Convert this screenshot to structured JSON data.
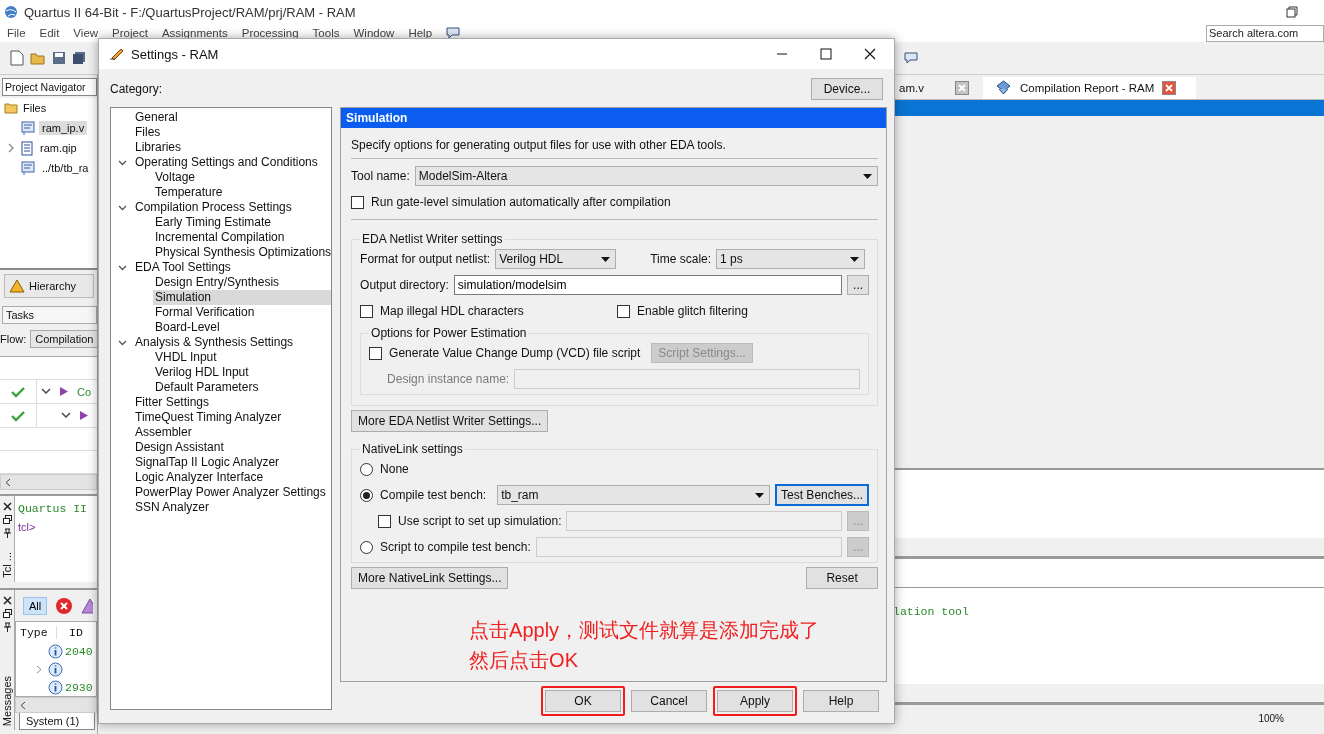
{
  "main_window": {
    "title": "Quartus II 64-Bit - F:/QuartusProject/RAM/prj/RAM - RAM",
    "menu": [
      "File",
      "Edit",
      "View",
      "Project",
      "Assignments",
      "Processing",
      "Tools",
      "Window",
      "Help"
    ],
    "search": {
      "placeholder": "Search altera.com"
    },
    "navigator": {
      "label": "Project Navigator",
      "files": {
        "label": "Files",
        "children": [
          {
            "label": "ram_ip.v",
            "kind": "source",
            "expandable": false,
            "selected": true
          },
          {
            "label": "ram.qip",
            "kind": "list",
            "expandable": true,
            "selected": false
          },
          {
            "label": "../tb/tb_ra",
            "kind": "source",
            "expandable": false,
            "selected": false
          }
        ]
      },
      "tab": "Hierarchy"
    },
    "tasks": {
      "label": "Tasks",
      "flow_label": "Flow:",
      "flow": "Compilation",
      "rows": [
        {
          "done": true,
          "label": "Co",
          "children": [
            {
              "done": true
            }
          ]
        }
      ]
    },
    "tcl": {
      "tab": "Tcl ...",
      "lines": [
        {
          "kind": "output",
          "text": "Quartus II"
        },
        {
          "kind": "prompt",
          "text": "tcl>"
        }
      ]
    },
    "messages": {
      "tab": "Messages",
      "filter": "All",
      "columns": [
        "Type",
        "ID"
      ],
      "rows": [
        {
          "id": "2040",
          "expandable": false
        },
        {
          "expandable": true
        },
        {
          "id": "2930",
          "expandable": false
        }
      ],
      "bottom_tab": "System (1)"
    },
    "documents": [
      {
        "label": "am.v",
        "selected": false
      },
      {
        "label": "Compilation Report - RAM",
        "selected": true
      }
    ],
    "message_text": "lation tool",
    "zoom": "100%"
  },
  "dialog": {
    "title": "Settings - RAM",
    "category_label": "Category:",
    "device_button": "Device...",
    "categories": [
      {
        "label": "General",
        "selected": false
      },
      {
        "label": "Files",
        "selected": false
      },
      {
        "label": "Libraries",
        "selected": false
      },
      {
        "label": "Operating Settings and Conditions",
        "selected": false,
        "expanded": true,
        "children": [
          {
            "label": "Voltage",
            "selected": false
          },
          {
            "label": "Temperature",
            "selected": false
          }
        ]
      },
      {
        "label": "Compilation Process Settings",
        "selected": false,
        "expanded": true,
        "children": [
          {
            "label": "Early Timing Estimate",
            "selected": false
          },
          {
            "label": "Incremental Compilation",
            "selected": false
          },
          {
            "label": "Physical Synthesis Optimizations",
            "selected": false
          }
        ]
      },
      {
        "label": "EDA Tool Settings",
        "selected": false,
        "expanded": true,
        "children": [
          {
            "label": "Design Entry/Synthesis",
            "selected": false
          },
          {
            "label": "Simulation",
            "selected": true
          },
          {
            "label": "Formal Verification",
            "selected": false
          },
          {
            "label": "Board-Level",
            "selected": false
          }
        ]
      },
      {
        "label": "Analysis & Synthesis Settings",
        "selected": false,
        "expanded": true,
        "children": [
          {
            "label": "VHDL Input",
            "selected": false
          },
          {
            "label": "Verilog HDL Input",
            "selected": false
          },
          {
            "label": "Default Parameters",
            "selected": false
          }
        ]
      },
      {
        "label": "Fitter Settings",
        "selected": false
      },
      {
        "label": "TimeQuest Timing Analyzer",
        "selected": false
      },
      {
        "label": "Assembler",
        "selected": false
      },
      {
        "label": "Design Assistant",
        "selected": false
      },
      {
        "label": "SignalTap II Logic Analyzer",
        "selected": false
      },
      {
        "label": "Logic Analyzer Interface",
        "selected": false
      },
      {
        "label": "PowerPlay Power Analyzer Settings",
        "selected": false
      },
      {
        "label": "SSN Analyzer",
        "selected": false
      }
    ],
    "page": {
      "title": "Simulation",
      "description": "Specify options for generating output files for use with other EDA tools.",
      "tool_label": "Tool name:",
      "tool": "ModelSim-Altera",
      "run_gate": {
        "label": "Run gate-level simulation automatically after compilation",
        "checked": false
      },
      "netlist": {
        "title": "EDA Netlist Writer settings",
        "format_label": "Format for output netlist:",
        "format": "Verilog HDL",
        "timescale_label": "Time scale:",
        "timescale": "1 ps",
        "outdir_label": "Output directory:",
        "outdir": "simulation/modelsim",
        "browse": "...",
        "options": [
          {
            "label": "Map illegal HDL characters",
            "checked": false
          },
          {
            "label": "Enable glitch filtering",
            "checked": false
          }
        ],
        "power": {
          "title": "Options for Power Estimation",
          "vcd": {
            "label": "Generate Value Change Dump (VCD) file script",
            "checked": false
          },
          "script_button": {
            "label": "Script Settings...",
            "disabled": true
          },
          "instance_label": "Design instance name:",
          "instance_disabled": true
        }
      },
      "more_netlist": "More EDA Netlist Writer Settings...",
      "nativelink": {
        "title": "NativeLink settings",
        "rows": [
          {
            "kind": "radio",
            "label": "None",
            "selected": false
          },
          {
            "kind": "radio-combo",
            "label": "Compile test bench:",
            "selected": true,
            "value": "tb_ram",
            "button": "Test Benches...",
            "focused": true
          },
          {
            "kind": "checkbox-field",
            "label": "Use script to set up simulation:",
            "checked": false,
            "browse": "...",
            "disabled": true
          },
          {
            "kind": "radio-field",
            "label": "Script to compile test bench:",
            "selected": false,
            "browse": "...",
            "disabled": true
          }
        ]
      },
      "more_nativelink": "More NativeLink Settings...",
      "reset": "Reset",
      "annotation": [
        "点击Apply，测试文件就算是添加完成了",
        "然后点击OK"
      ]
    },
    "buttons": [
      {
        "label": "OK",
        "highlighted": true
      },
      {
        "label": "Cancel",
        "highlighted": false
      },
      {
        "label": "Apply",
        "highlighted": true
      },
      {
        "label": "Help",
        "highlighted": false
      }
    ]
  }
}
